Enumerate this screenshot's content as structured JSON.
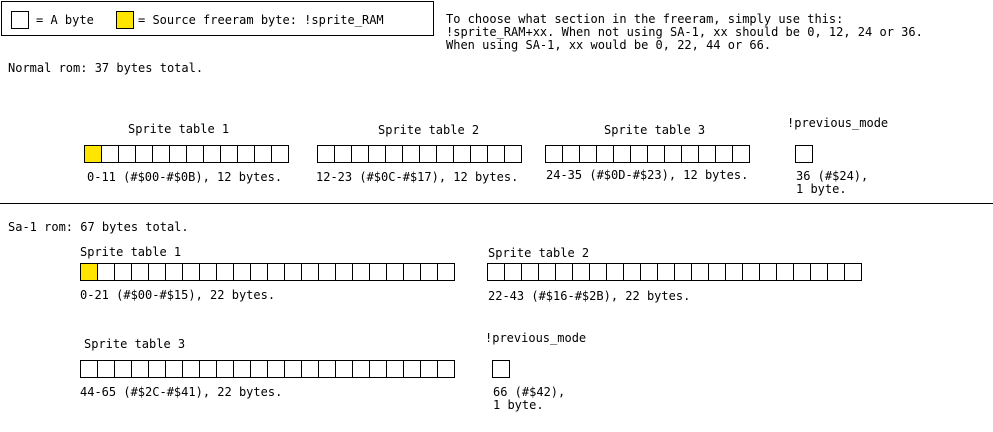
{
  "colors": {
    "source_byte": "#ffe500",
    "empty_byte": "#ffffff",
    "border": "#000000"
  },
  "legend": {
    "byte_label": "= A byte",
    "source_label": "= Source freeram byte: !sprite_RAM"
  },
  "instructions": {
    "line1": "To choose what section in the freeram, simply use this:",
    "line2": "!sprite_RAM+xx. When not using SA-1, xx should be 0, 12, 24 or 36.",
    "line3": "When using SA-1, xx would be 0, 22, 44 or 66."
  },
  "normal": {
    "title": "Normal rom: 37 bytes total.",
    "tables": [
      {
        "label": "Sprite table 1",
        "cells": 12,
        "source_index": 0,
        "range": "0-11 (#$00-#$0B), 12 bytes."
      },
      {
        "label": "Sprite table 2",
        "cells": 12,
        "source_index": -1,
        "range": "12-23 (#$0C-#$17), 12 bytes."
      },
      {
        "label": "Sprite table 3",
        "cells": 12,
        "source_index": -1,
        "range": "24-35 (#$0D-#$23), 12 bytes."
      },
      {
        "label": "!previous_mode",
        "cells": 1,
        "source_index": -1,
        "range_line1": "36 (#$24),",
        "range_line2": "1 byte."
      }
    ]
  },
  "sa1": {
    "title": "Sa-1 rom: 67 bytes total.",
    "tables": [
      {
        "label": "Sprite table 1",
        "cells": 22,
        "source_index": 0,
        "range": "0-21 (#$00-#$15), 22 bytes."
      },
      {
        "label": "Sprite table 2",
        "cells": 22,
        "source_index": -1,
        "range": "22-43 (#$16-#$2B), 22 bytes."
      },
      {
        "label": "Sprite table 3",
        "cells": 22,
        "source_index": -1,
        "range": "44-65 (#$2C-#$41), 22 bytes."
      },
      {
        "label": "!previous_mode",
        "cells": 1,
        "source_index": -1,
        "range_line1": "66 (#$42),",
        "range_line2": "1 byte."
      }
    ]
  }
}
